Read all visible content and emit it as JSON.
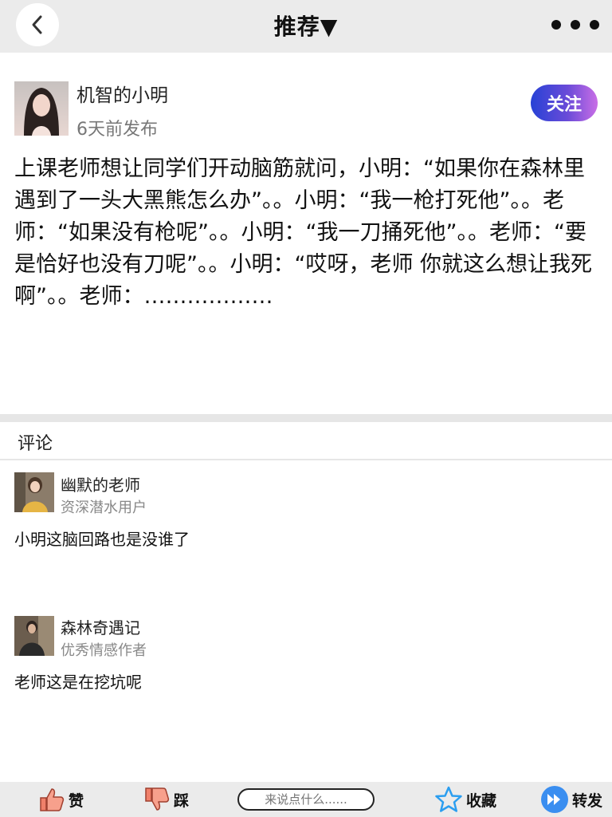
{
  "header": {
    "title": "推荐▼"
  },
  "post": {
    "author_name": "机智的小明",
    "time": "6天前发布",
    "follow_label": "关注",
    "content": "上课老师想让同学们开动脑筋就问，小明：“如果你在森林里遇到了一头大黑熊怎么办”。。小明：“我一枪打死他”。。老师：“如果没有枪呢”。。小明：“我一刀捅死他”。。老师：“要是恰好也没有刀呢”。。小明：“哎呀，老师 你就这么想让我死啊”。。老师：………………"
  },
  "comments": {
    "heading": "评论",
    "items": [
      {
        "name": "幽默的老师",
        "badge": "资深潜水用户",
        "text": "小明这脑回路也是没谁了"
      },
      {
        "name": "森林奇遇记",
        "badge": "优秀情感作者",
        "text": "老师这是在挖坑呢"
      }
    ]
  },
  "bottom_bar": {
    "like_label": "赞",
    "dislike_label": "踩",
    "comment_placeholder": "来说点什么......",
    "favorite_label": "收藏",
    "share_label": "转发"
  },
  "colors": {
    "follow_gradient_start": "#2742d6",
    "follow_gradient_end": "#c96ee6",
    "favorite_icon": "#2b9ef0",
    "share_icon": "#3a8ef0",
    "like_icon": "#f0806a"
  }
}
